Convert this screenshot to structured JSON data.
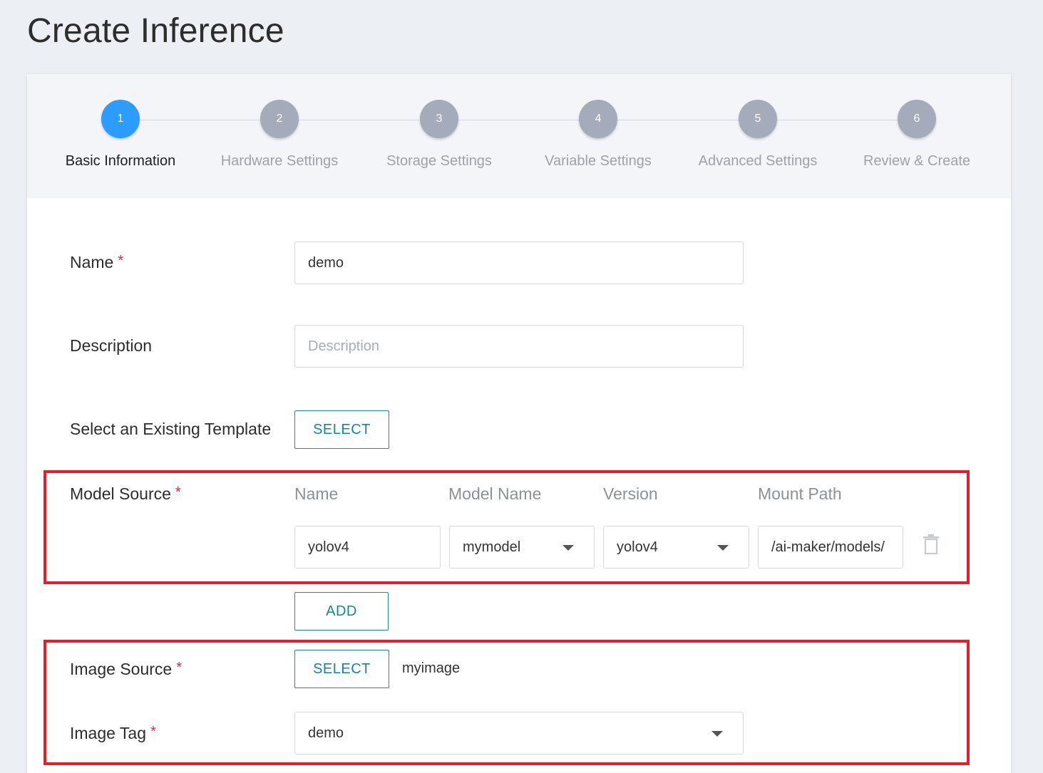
{
  "page": {
    "title": "Create Inference"
  },
  "stepper": {
    "steps": [
      {
        "number": "1",
        "label": "Basic Information",
        "active": true
      },
      {
        "number": "2",
        "label": "Hardware Settings",
        "active": false
      },
      {
        "number": "3",
        "label": "Storage Settings",
        "active": false
      },
      {
        "number": "4",
        "label": "Variable Settings",
        "active": false
      },
      {
        "number": "5",
        "label": "Advanced Settings",
        "active": false
      },
      {
        "number": "6",
        "label": "Review & Create",
        "active": false
      }
    ]
  },
  "form": {
    "name": {
      "label": "Name",
      "required": "*",
      "value": "demo"
    },
    "description": {
      "label": "Description",
      "value": "",
      "placeholder": "Description"
    },
    "template": {
      "label": "Select an Existing Template",
      "button": "SELECT"
    },
    "model_source": {
      "label": "Model Source",
      "required": "*",
      "columns": [
        "Name",
        "Model Name",
        "Version",
        "Mount Path"
      ],
      "row": {
        "name": "yolov4",
        "model_name": "mymodel",
        "version": "yolov4",
        "mount_path": "/ai-maker/models/"
      },
      "add_button": "ADD",
      "delete_icon": "trash-icon"
    },
    "image_source": {
      "label": "Image Source",
      "required": "*",
      "button": "SELECT",
      "value": "myimage"
    },
    "image_tag": {
      "label": "Image Tag",
      "required": "*",
      "value": "demo"
    }
  },
  "colors": {
    "accent": "#2d9cff",
    "button_text": "#15859f",
    "highlight": "#e0202f",
    "required": "#e02a3a"
  }
}
